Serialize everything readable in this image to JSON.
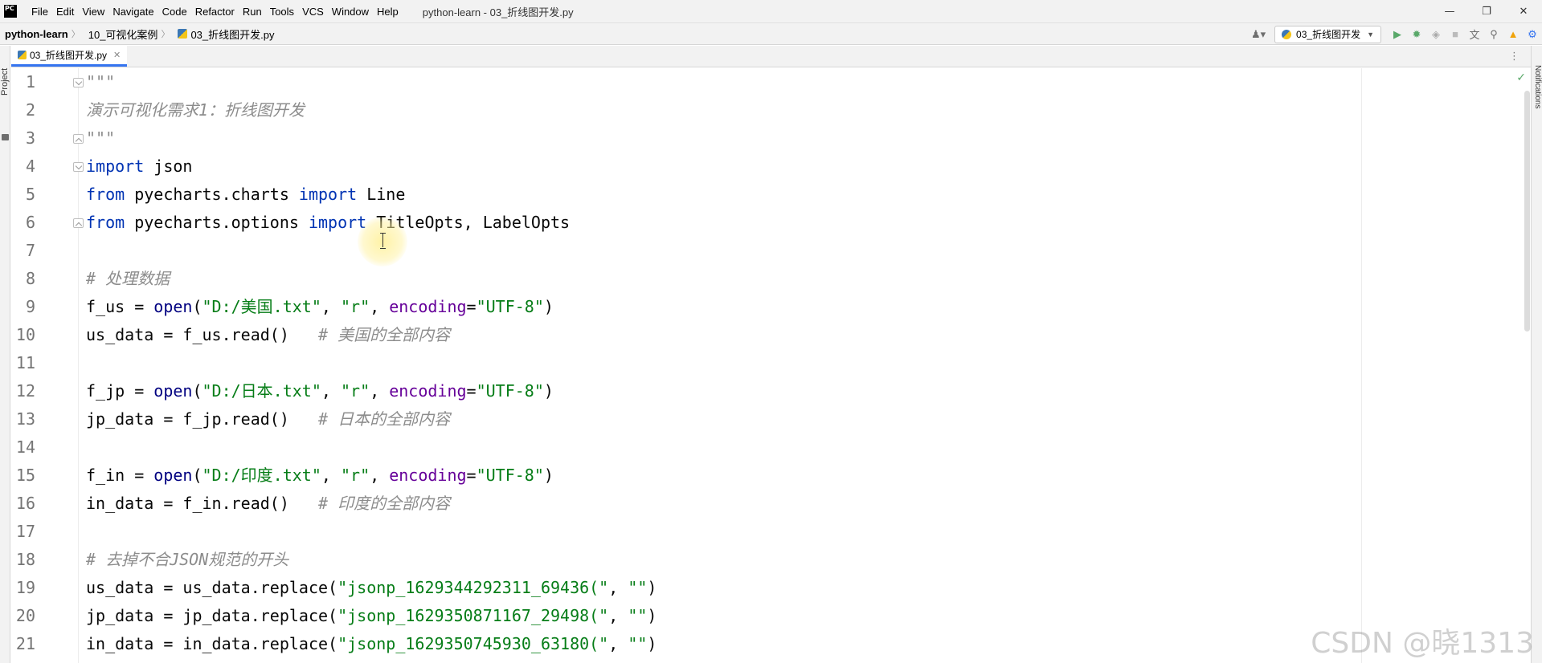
{
  "app": {
    "logo_text": "PC",
    "window_title": "python-learn - 03_折线图开发.py"
  },
  "menu": [
    "File",
    "Edit",
    "View",
    "Navigate",
    "Code",
    "Refactor",
    "Run",
    "Tools",
    "VCS",
    "Window",
    "Help"
  ],
  "breadcrumb": {
    "project": "python-learn",
    "folder": "10_可视化案例",
    "file": "03_折线图开发.py"
  },
  "toolbar": {
    "run_config": "03_折线图开发"
  },
  "tool_windows": {
    "left": "Project",
    "right": "Notifications"
  },
  "tab": {
    "label": "03_折线图开发.py"
  },
  "code_lines": [
    "\"\"\"",
    "演示可视化需求1：折线图开发",
    "\"\"\"",
    "import json",
    "from pyecharts.charts import Line",
    "from pyecharts.options import TitleOpts, LabelOpts",
    "",
    "# 处理数据",
    "f_us = open(\"D:/美国.txt\", \"r\", encoding=\"UTF-8\")",
    "us_data = f_us.read()   # 美国的全部内容",
    "",
    "f_jp = open(\"D:/日本.txt\", \"r\", encoding=\"UTF-8\")",
    "jp_data = f_jp.read()   # 日本的全部内容",
    "",
    "f_in = open(\"D:/印度.txt\", \"r\", encoding=\"UTF-8\")",
    "in_data = f_in.read()   # 印度的全部内容",
    "",
    "# 去掉不合JSON规范的开头",
    "us_data = us_data.replace(\"jsonp_1629344292311_69436(\", \"\")",
    "jp_data = jp_data.replace(\"jsonp_1629350871167_29498(\", \"\")",
    "in_data = in_data.replace(\"jsonp_1629350745930_63180(\", \"\")"
  ],
  "watermark": "CSDN @晓1313"
}
